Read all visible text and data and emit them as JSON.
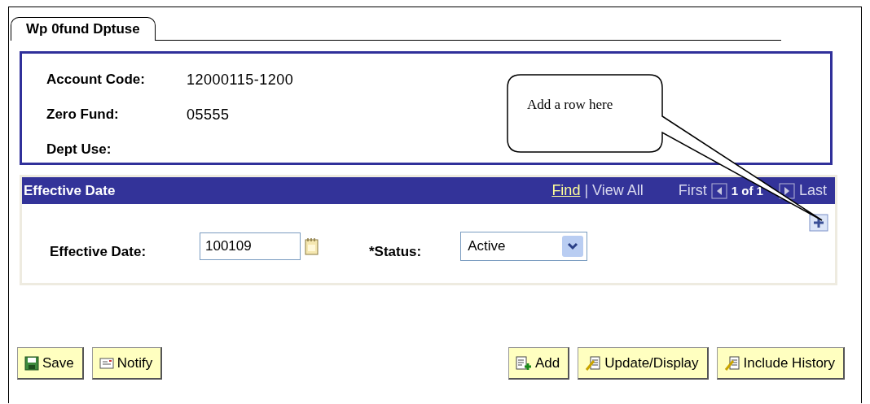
{
  "tab": {
    "label": "Wp 0fund Dptuse",
    "selected": true
  },
  "fields": [
    {
      "label": "Account Code:",
      "value": "12000115-1200"
    },
    {
      "label": "Zero Fund:",
      "value": "05555"
    },
    {
      "label": "Dept Use:"
    }
  ],
  "callout": {
    "text": "Add a row here"
  },
  "grid": {
    "title": "Effective Date",
    "find": "Find",
    "separator": "|",
    "view_all": "View All",
    "first": "First",
    "count": "1 of 1",
    "last": "Last",
    "date_label": "Effective Date:",
    "date_value": "100109",
    "status_label": "*Status:",
    "status_value": "Active"
  },
  "buttons_left": [
    {
      "label": "Save",
      "kind": "save"
    },
    {
      "label": "Notify",
      "kind": "notify"
    }
  ],
  "buttons_right": [
    {
      "label": "Add",
      "kind": "add"
    },
    {
      "label": "Update/Display",
      "kind": "update"
    },
    {
      "label": "Include History",
      "kind": "history"
    }
  ]
}
